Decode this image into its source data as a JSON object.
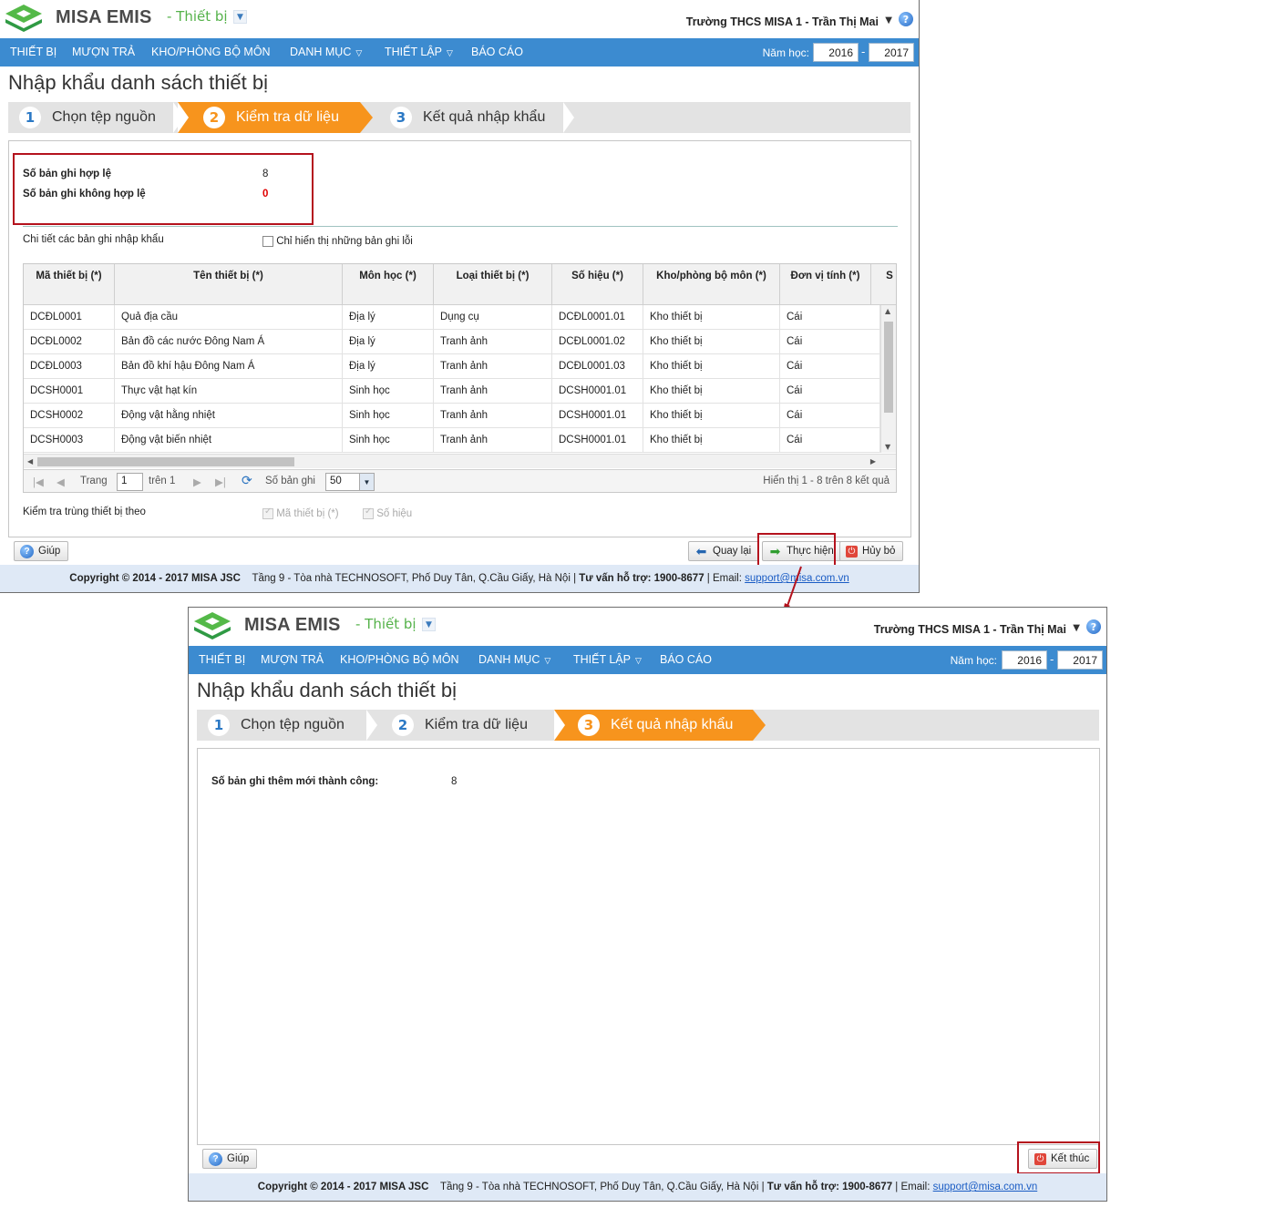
{
  "app": {
    "brand": "MISA EMIS",
    "module": "- Thiết bị",
    "user": "Trường THCS MISA 1 - Trần Thị Mai",
    "nav": [
      "THIẾT BỊ",
      "MƯỢN TRẢ",
      "KHO/PHÒNG BỘ MÔN",
      "DANH MỤC",
      "THIẾT LẬP",
      "BÁO CÁO"
    ],
    "year_label": "Năm học:",
    "year_from": "2016",
    "year_to": "2017",
    "page_title": "Nhập khẩu danh sách thiết bị",
    "steps": [
      {
        "num": "1",
        "label": "Chọn tệp nguồn"
      },
      {
        "num": "2",
        "label": "Kiểm tra dữ liệu"
      },
      {
        "num": "3",
        "label": "Kết quả nhập khẩu"
      }
    ],
    "footer": {
      "copyright": "Copyright © 2014 - 2017 MISA JSC",
      "address": "Tầng 9 - Tòa nhà TECHNOSOFT, Phố Duy Tân, Q.Cầu Giấy, Hà Nội |",
      "hotline": "Tư vấn hỗ trợ: 1900-8677",
      "email_label": "| Email:",
      "email": "support@misa.com.vn"
    },
    "help_button": "Giúp"
  },
  "screen1": {
    "valid_label": "Số bản ghi hợp lệ",
    "valid_value": "8",
    "invalid_label": "Số bản ghi không hợp lệ",
    "invalid_value": "0",
    "details_label": "Chi tiết các bản ghi nhập khẩu",
    "only_errors_label": "Chỉ hiển thị những bản ghi lỗi",
    "columns": [
      "Mã thiết bị (*)",
      "Tên thiết bị (*)",
      "Môn học (*)",
      "Loại thiết bị (*)",
      "Số hiệu (*)",
      "Kho/phòng bộ môn (*)",
      "Đơn vị tính (*)",
      "S"
    ],
    "rows": [
      [
        "DCĐL0001",
        "Quả địa cầu",
        "Địa lý",
        "Dụng cụ",
        "DCĐL0001.01",
        "Kho thiết bị",
        "Cái"
      ],
      [
        "DCĐL0002",
        "Bản đồ các nước Đông Nam Á",
        "Địa lý",
        "Tranh ảnh",
        "DCĐL0001.02",
        "Kho thiết bị",
        "Cái"
      ],
      [
        "DCĐL0003",
        "Bản đồ khí hậu Đông Nam Á",
        "Địa lý",
        "Tranh ảnh",
        "DCĐL0001.03",
        "Kho thiết bị",
        "Cái"
      ],
      [
        "DCSH0001",
        "Thực vật hạt kín",
        "Sinh học",
        "Tranh ảnh",
        "DCSH0001.01",
        "Kho thiết bị",
        "Cái"
      ],
      [
        "DCSH0002",
        "Động vật hằng nhiệt",
        "Sinh học",
        "Tranh ảnh",
        "DCSH0001.01",
        "Kho thiết bị",
        "Cái"
      ],
      [
        "DCSH0003",
        "Động vật biến nhiệt",
        "Sinh học",
        "Tranh ảnh",
        "DCSH0001.01",
        "Kho thiết bị",
        "Cái"
      ]
    ],
    "pager": {
      "page_label": "Trang",
      "page_value": "1",
      "of_label": "trên 1",
      "size_label": "Số bản ghi",
      "size_value": "50",
      "summary": "Hiển thị 1 - 8 trên 8 kết quả"
    },
    "dup_check_label": "Kiểm tra trùng thiết bị theo",
    "dup_opt1": "Mã thiết bị (*)",
    "dup_opt2": "Số hiệu",
    "back_button": "Quay lại",
    "execute_button": "Thực hiện",
    "cancel_button": "Hủy bỏ"
  },
  "screen2": {
    "success_label": "Số bản ghi thêm mới thành công:",
    "success_value": "8",
    "finish_button": "Kết thúc"
  },
  "colors": {
    "nav_blue": "#3c8bd0",
    "step_orange": "#f7941d",
    "highlight_red": "#b4121d",
    "error_red": "#e00000",
    "brand_green": "#55b24a"
  }
}
